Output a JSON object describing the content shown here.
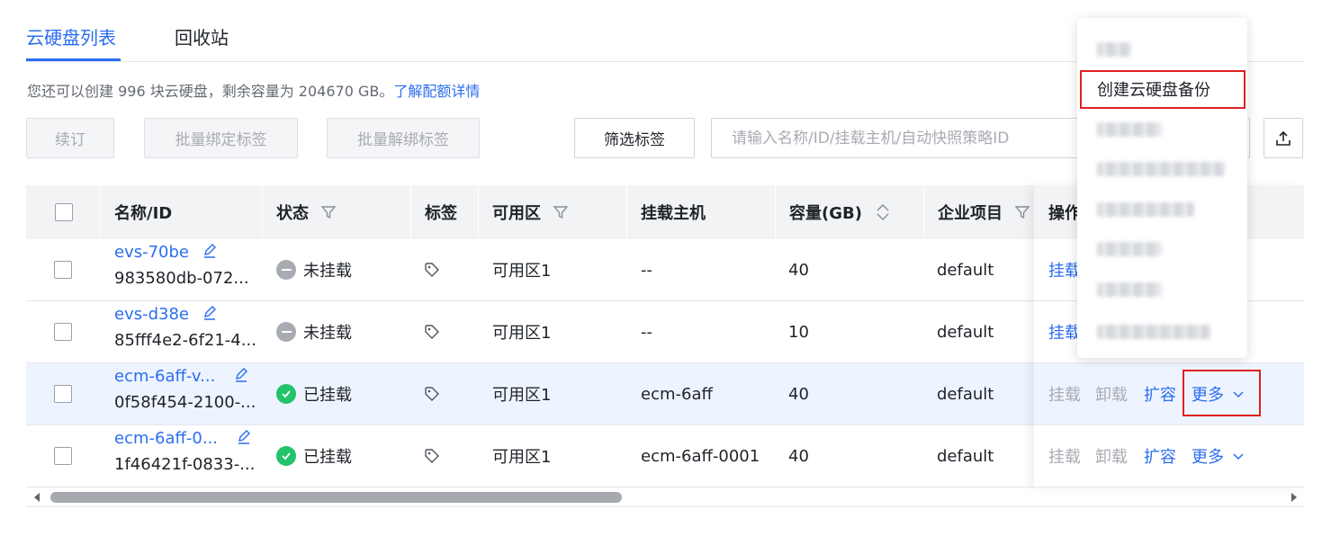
{
  "tabs": [
    {
      "label": "云硬盘列表",
      "active": true
    },
    {
      "label": "回收站",
      "active": false
    }
  ],
  "quota": {
    "text": "您还可以创建 996 块云硬盘，剩余容量为 204670 GB。",
    "link": "了解配额详情"
  },
  "toolbar": {
    "renew": "续订",
    "batch_bind_tags": "批量绑定标签",
    "batch_unbind_tags": "批量解绑标签",
    "filter_tags": "筛选标签",
    "search_placeholder": "请输入名称/ID/挂载主机/自动快照策略ID"
  },
  "table": {
    "headers": {
      "name": "名称/ID",
      "status": "状态",
      "tags": "标签",
      "zone": "可用区",
      "host": "挂载主机",
      "capacity": "容量(GB)",
      "project": "企业项目",
      "ops": "操作"
    },
    "rows": [
      {
        "name": "evs-70be",
        "id": "983580db-072...",
        "status": "未挂载",
        "status_type": "detached",
        "zone": "可用区1",
        "host": "--",
        "capacity": "40",
        "project": "default",
        "actions": [
          "挂载"
        ]
      },
      {
        "name": "evs-d38e",
        "id": "85fff4e2-6f21-4...",
        "status": "未挂载",
        "status_type": "detached",
        "zone": "可用区1",
        "host": "--",
        "capacity": "10",
        "project": "default",
        "actions": [
          "挂载"
        ]
      },
      {
        "name": "ecm-6aff-v...",
        "id": "0f58f454-2100-...",
        "status": "已挂载",
        "status_type": "attached",
        "zone": "可用区1",
        "host": "ecm-6aff",
        "capacity": "40",
        "project": "default",
        "actions": [
          "挂载",
          "卸载",
          "扩容",
          "更多"
        ]
      },
      {
        "name": "ecm-6aff-0...",
        "id": "1f46421f-0833-...",
        "status": "已挂载",
        "status_type": "attached",
        "zone": "可用区1",
        "host": "ecm-6aff-0001",
        "capacity": "40",
        "project": "default",
        "actions": [
          "挂载",
          "卸载",
          "扩容",
          "更多"
        ]
      }
    ]
  },
  "dropdown": {
    "highlighted_item": "创建云硬盘备份"
  },
  "colors": {
    "accent": "#2b6def",
    "attached": "#22c36a",
    "detached": "#a8abb2",
    "highlight_box": "#e02020"
  }
}
